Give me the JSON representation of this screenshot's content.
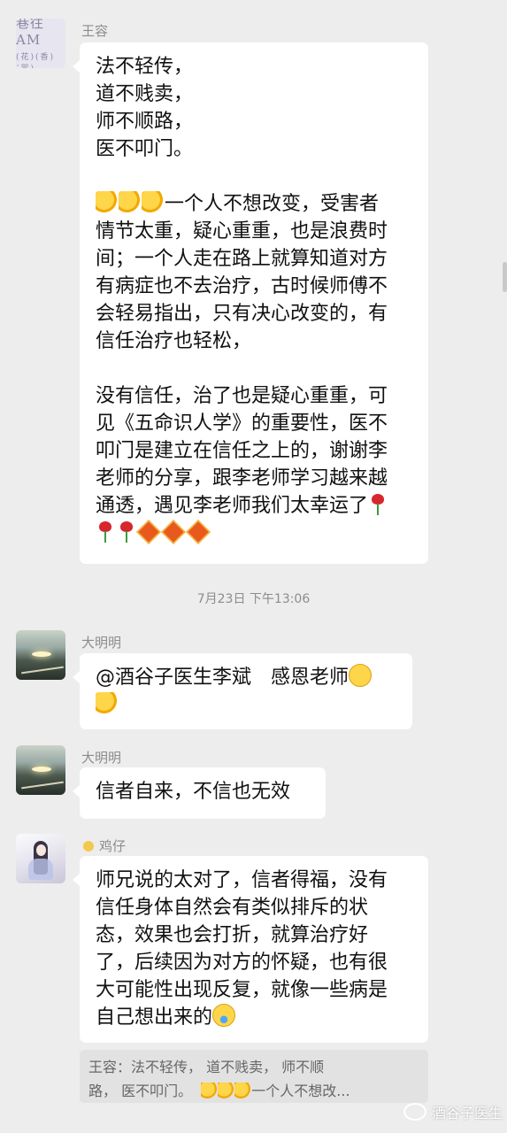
{
  "messages": [
    {
      "sender": "王容",
      "avatar_text_top": "巷往AM",
      "avatar_text_bottom": "(花)(香)(咒)",
      "lines": [
        "法不轻传，",
        "道不贱卖，",
        "师不顺路，",
        "医不叩门。"
      ],
      "para2_start_emoji": "thumbs-up x3",
      "para2_lines": [
        "一个人不想改变，受害者",
        "情节太重，疑心重重，也是浪费时",
        "间；一个人走在路上就算知道对方",
        "有病症也不去治疗，古时候师傅不",
        "会轻易指出，只有决心改变的，有",
        "信任治疗也轻松，"
      ],
      "para3_lines": [
        "没有信任，治了也是疑心重重，可",
        "见《五命识人学》的重要性，医不",
        "叩门是建立在信任之上的，谢谢李",
        "老师的分享，跟李老师学习越来越",
        "通透，遇见李老师我们太幸运了"
      ]
    },
    {
      "sender": "大明明",
      "line1": "@酒谷子医生李斌　感恩老师"
    },
    {
      "sender": "大明明",
      "line1": "信者自来，不信也无效"
    },
    {
      "sender": "鸡仔",
      "lines": [
        "师兄说的太对了，信者得福，没有",
        "信任身体自然会有类似排斥的状",
        "态，效果也会打折，就算治疗好",
        "了，后续因为对方的怀疑，也有很",
        "大可能性出现反复，就像一些病是",
        "自己想出来的"
      ]
    }
  ],
  "timestamp": "7月23日 下午13:06",
  "quote": {
    "line1": "王容：法不轻传，  道不贱卖，  师不顺",
    "line2_start": "路，  医不叩门。",
    "line2_end": "一个人不想改..."
  },
  "watermark": "酒谷子医生",
  "colors": {
    "background": "#ededed",
    "bubble": "#ffffff",
    "name": "#8c8c8c",
    "quote_bg": "#e2e2e2"
  },
  "icons": [
    "thumbs-up-emoji",
    "rose-emoji",
    "fu-diamond-emoji",
    "smile-emoji",
    "laugh-cry-emoji"
  ]
}
